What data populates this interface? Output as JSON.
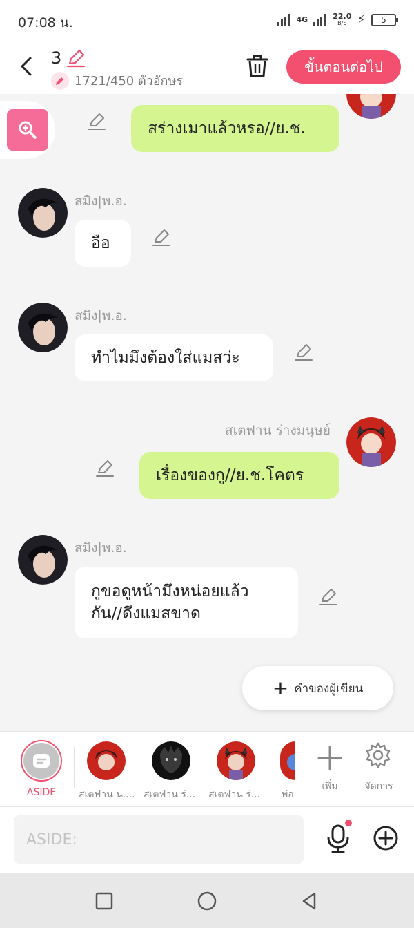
{
  "status": {
    "time": "07:08 น.",
    "network": "4G",
    "speed": "22.0",
    "speed_unit": "B/S",
    "battery": "5"
  },
  "header": {
    "episode": "3",
    "char_count": "1721/450 ตัวอักษร",
    "next_label": "ขั้นตอนต่อไป",
    "accent": "#f3506f"
  },
  "messages": [
    {
      "side": "right",
      "text": "สร่างเมาแล้วหรอ//ย.ช."
    },
    {
      "side": "left",
      "name": "สมิง|พ.อ.",
      "text": "อือ"
    },
    {
      "side": "left",
      "name": "สมิง|พ.อ.",
      "text": "ทำไมมึงต้องใส่แมสว่ะ"
    },
    {
      "side": "right",
      "name": "สเตฟาน ร่างมนุษย์",
      "text": "เรื่องของกู//ย.ช.โคตร"
    },
    {
      "side": "left",
      "name": "สมิง|พ.อ.",
      "text_line1": "กูขอดูหน้ามึงหน่อยแล้ว",
      "text_line2": "กัน//ดึงแมสขาด"
    }
  ],
  "writer_button": "คำของผู้เขียน",
  "characters": {
    "aside": "ASIDE",
    "items": [
      "สเตฟาน น....",
      "สเตฟาน ร่...",
      "สเตฟาน ร่...",
      "พ่อ"
    ],
    "add_label": "เพิ่ม",
    "manage_label": "จัดการ"
  },
  "input": {
    "placeholder": "ASIDE:"
  }
}
